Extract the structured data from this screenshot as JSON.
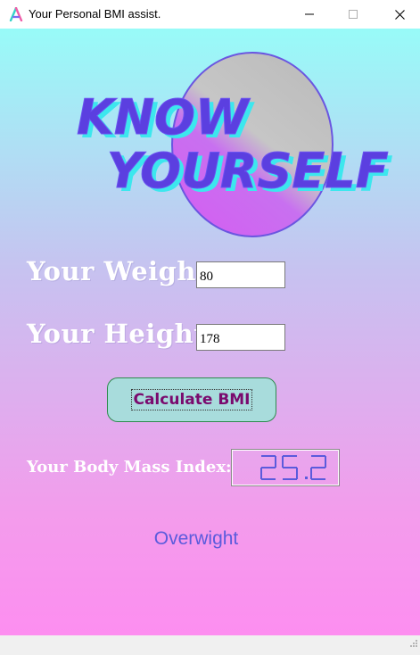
{
  "window": {
    "title": "Your Personal BMI assist.",
    "controls": [
      "minimize",
      "maximize",
      "close"
    ]
  },
  "hero": {
    "line1": "KNOW",
    "line2": "YOURSELF"
  },
  "form": {
    "weight_label": "Your Weight",
    "weight_value": "80",
    "height_label": "Your Height",
    "height_value": "178"
  },
  "calculate_button": "Calculate BMI",
  "result": {
    "label": "Your Body Mass Index:",
    "value": "25.2",
    "category": "Overwight"
  },
  "colors": {
    "gradient_top": "#98fbf8",
    "gradient_bottom": "#fd8ef0",
    "accent_purple": "#5b4bdc",
    "button_bg": "#a8dcdc",
    "button_text": "#7a0a6e",
    "lcd_digits": "#5b5bdc"
  },
  "icons": {
    "app": "app-logo-icon",
    "minimize": "minimize-icon",
    "maximize": "maximize-icon",
    "close": "close-icon",
    "grip": "resize-grip-icon"
  }
}
